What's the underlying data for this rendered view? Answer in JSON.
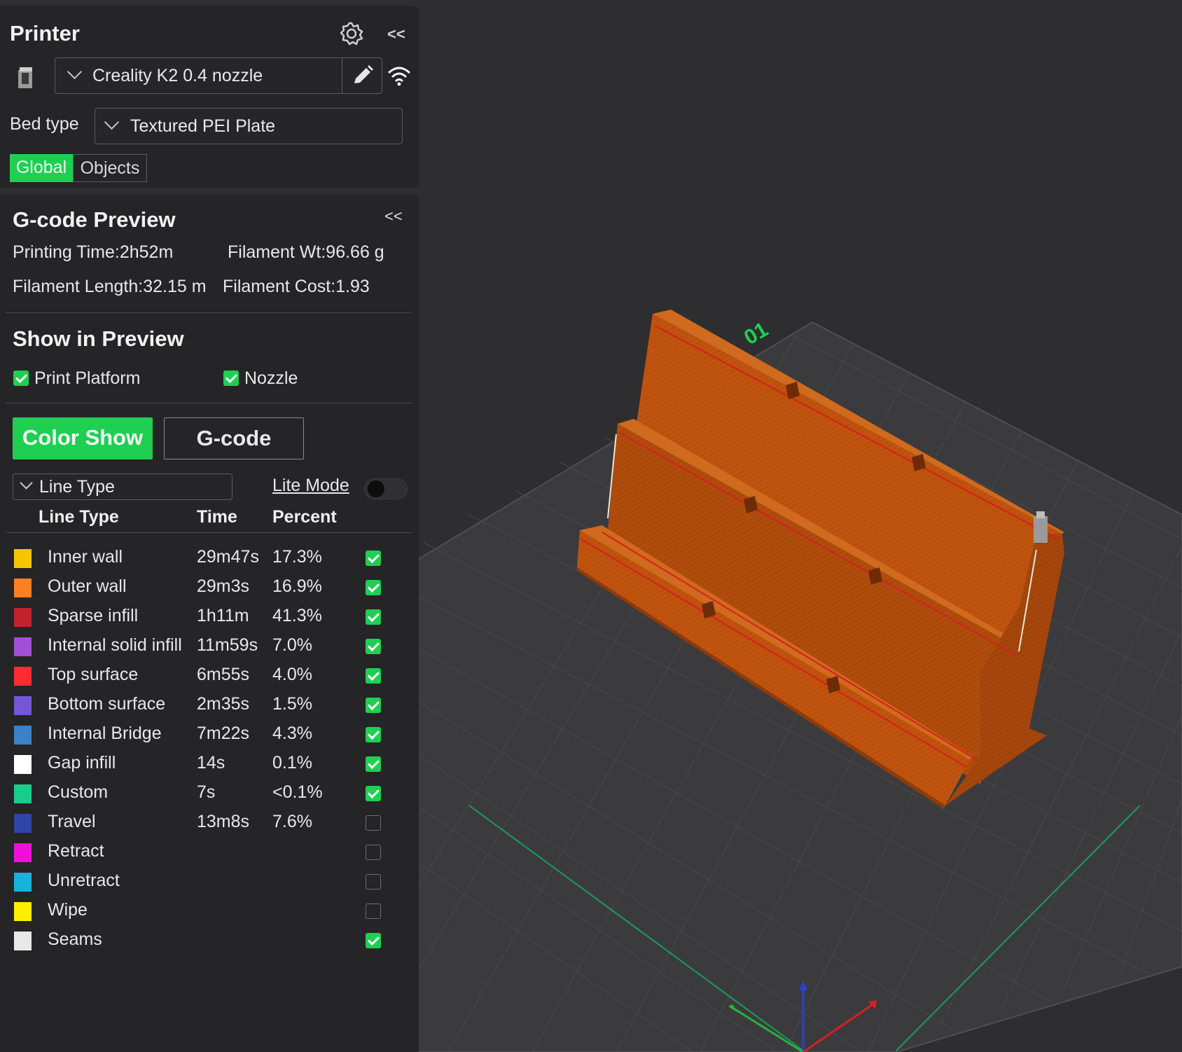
{
  "printer": {
    "title": "Printer",
    "printer_name": "Creality K2 0.4 nozzle",
    "bed_type_label": "Bed type",
    "bed_type_value": "Textured PEI Plate",
    "tabs": [
      {
        "label": "Global",
        "active": true
      },
      {
        "label": "Objects",
        "active": false
      }
    ],
    "collapse_label": "<<"
  },
  "gcode_preview": {
    "title": "G-code Preview",
    "collapse_label": "<<",
    "printing_time": "Printing Time:2h52m",
    "filament_wt": "Filament Wt:96.66 g",
    "filament_length": "Filament Length:32.15 m",
    "filament_cost": "Filament Cost:1.93"
  },
  "show_in_preview": {
    "title": "Show in Preview",
    "options": [
      {
        "label": "Print Platform",
        "checked": true
      },
      {
        "label": "Nozzle",
        "checked": true
      }
    ]
  },
  "view_mode": {
    "color_show_label": "Color Show",
    "gcode_label": "G-code",
    "line_type_dropdown": "Line Type",
    "lite_mode_label": "Lite Mode",
    "lite_mode_on": false
  },
  "table": {
    "headers": {
      "name": "Line Type",
      "time": "Time",
      "percent": "Percent"
    },
    "rows": [
      {
        "name": "Inner wall",
        "time": "29m47s",
        "percent": "17.3%",
        "color": "#f7c500",
        "checked": true
      },
      {
        "name": "Outer wall",
        "time": "29m3s",
        "percent": "16.9%",
        "color": "#ff7f21",
        "checked": true
      },
      {
        "name": "Sparse infill",
        "time": "1h11m",
        "percent": "41.3%",
        "color": "#c3222b",
        "checked": true
      },
      {
        "name": "Internal solid infill",
        "time": "11m59s",
        "percent": "7.0%",
        "color": "#a04fd6",
        "checked": true
      },
      {
        "name": "Top surface",
        "time": "6m55s",
        "percent": "4.0%",
        "color": "#ff2b30",
        "checked": true
      },
      {
        "name": "Bottom surface",
        "time": "2m35s",
        "percent": "1.5%",
        "color": "#7357d8",
        "checked": true
      },
      {
        "name": "Internal Bridge",
        "time": "7m22s",
        "percent": "4.3%",
        "color": "#3a82c5",
        "checked": true
      },
      {
        "name": "Gap infill",
        "time": "14s",
        "percent": "0.1%",
        "color": "#ffffff",
        "checked": true
      },
      {
        "name": "Custom",
        "time": "7s",
        "percent": "<0.1%",
        "color": "#18cc8e",
        "checked": true
      },
      {
        "name": "Travel",
        "time": "13m8s",
        "percent": "7.6%",
        "color": "#2f45a8",
        "checked": false
      },
      {
        "name": "Retract",
        "time": "",
        "percent": "",
        "color": "#f010de",
        "checked": false
      },
      {
        "name": "Unretract",
        "time": "",
        "percent": "",
        "color": "#14b4dc",
        "checked": false
      },
      {
        "name": "Wipe",
        "time": "",
        "percent": "",
        "color": "#ffee00",
        "checked": false
      },
      {
        "name": "Seams",
        "time": "",
        "percent": "",
        "color": "#e8e8e8",
        "checked": true
      }
    ]
  },
  "plate": {
    "label": "01"
  },
  "colors": {
    "accent": "#1fcf52",
    "model": "#c0530e",
    "background": "#2e2e30",
    "panel": "#252527"
  },
  "icons": [
    "gear-icon",
    "collapse-icon",
    "printer-icon",
    "edit-icon",
    "wifi-icon",
    "chevron-down-icon",
    "checkbox-icon",
    "toggle-icon"
  ]
}
